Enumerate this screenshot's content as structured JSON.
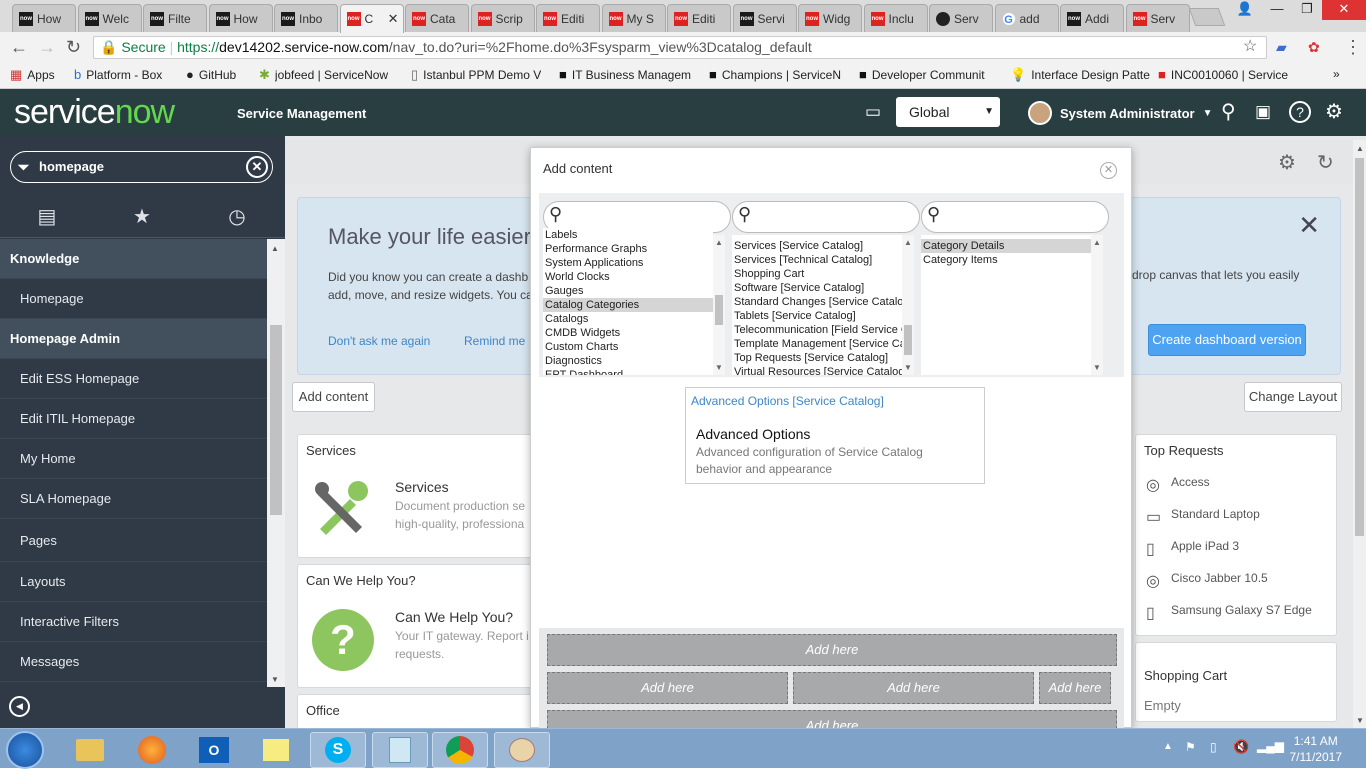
{
  "browser": {
    "tabs": [
      {
        "label": "How",
        "icon": "servicenow-icon",
        "active": false
      },
      {
        "label": "Welc",
        "icon": "servicenow-icon",
        "active": false
      },
      {
        "label": "Filte",
        "icon": "servicenow-icon",
        "active": false
      },
      {
        "label": "How",
        "icon": "servicenow-icon",
        "active": false
      },
      {
        "label": "Inbo",
        "icon": "servicenow-icon",
        "active": false
      },
      {
        "label": "C",
        "icon": "servicenow-red-icon",
        "active": true
      },
      {
        "label": "Cata",
        "icon": "servicenow-red-icon",
        "active": false
      },
      {
        "label": "Scrip",
        "icon": "servicenow-red-icon",
        "active": false
      },
      {
        "label": "Editi",
        "icon": "servicenow-red-icon",
        "active": false
      },
      {
        "label": "My S",
        "icon": "servicenow-red-icon",
        "active": false
      },
      {
        "label": "Editi",
        "icon": "servicenow-red-icon",
        "active": false
      },
      {
        "label": "Servi",
        "icon": "servicenow-icon",
        "active": false
      },
      {
        "label": "Widg",
        "icon": "servicenow-red-icon",
        "active": false
      },
      {
        "label": "Inclu",
        "icon": "servicenow-red-icon",
        "active": false
      },
      {
        "label": "Serv",
        "icon": "github-icon",
        "active": false
      },
      {
        "label": "add",
        "icon": "google-icon",
        "active": false
      },
      {
        "label": "Addi",
        "icon": "servicenow-icon",
        "active": false
      },
      {
        "label": "Serv",
        "icon": "servicenow-red-icon",
        "active": false
      }
    ],
    "address": {
      "secure_label": "Secure",
      "url_scheme": "https://",
      "url_host": "dev14202.service-now.com",
      "url_path": "/nav_to.do?uri=%2Fhome.do%3Fsysparm_view%3Dcatalog_default"
    },
    "bookmarks": [
      {
        "label": "Apps",
        "icon": "apps-grid-icon"
      },
      {
        "label": "Platform - Box",
        "icon": "box-icon"
      },
      {
        "label": "GitHub",
        "icon": "github-icon"
      },
      {
        "label": "jobfeed | ServiceNow",
        "icon": "jobfeed-icon"
      },
      {
        "label": "Istanbul PPM Demo V",
        "icon": "page-icon"
      },
      {
        "label": "IT Business Managem",
        "icon": "servicenow-icon"
      },
      {
        "label": "Champions | ServiceN",
        "icon": "servicenow-icon"
      },
      {
        "label": "Developer Communit",
        "icon": "servicenow-icon"
      },
      {
        "label": "Interface Design Patte",
        "icon": "lightbulb-icon"
      },
      {
        "label": "INC0010060 | Service",
        "icon": "servicenow-red-icon"
      }
    ],
    "more_bookmarks": "»"
  },
  "header": {
    "logo_service": "service",
    "logo_now": "now",
    "product": "Service Management",
    "scope": "Global",
    "user": "System Administrator"
  },
  "leftnav": {
    "filter_value": "homepage",
    "items": [
      {
        "label": "Knowledge",
        "type": "section"
      },
      {
        "label": "Homepage",
        "type": "item"
      },
      {
        "label": "Homepage Admin",
        "type": "section"
      },
      {
        "label": "Edit ESS Homepage",
        "type": "item"
      },
      {
        "label": "Edit ITIL Homepage",
        "type": "item"
      },
      {
        "label": "My Home",
        "type": "item"
      },
      {
        "label": "SLA Homepage",
        "type": "item"
      },
      {
        "label": "Pages",
        "type": "item"
      },
      {
        "label": "Layouts",
        "type": "item"
      },
      {
        "label": "Interactive Filters",
        "type": "item"
      },
      {
        "label": "Messages",
        "type": "item"
      }
    ]
  },
  "banner": {
    "title": "Make your life easier",
    "text": "Did you know you can create a dashb add, move, and resize widgets. You ca",
    "text_right": "drop canvas that lets you easily",
    "dont_ask": "Don't ask me again",
    "remind": "Remind me",
    "create_button": "Create dashboard version"
  },
  "toolbar": {
    "add_content": "Add content",
    "change_layout": "Change Layout"
  },
  "widgets": {
    "services": {
      "title": "Services",
      "name": "Services",
      "desc": "Document production se high-quality, professiona"
    },
    "help": {
      "title": "Can We Help You?",
      "name": "Can We Help You?",
      "desc": "Your IT gateway. Report i requests."
    },
    "office": {
      "title": "Office"
    },
    "top_requests": {
      "title": "Top Requests",
      "items": [
        {
          "label": "Access",
          "icon": "catalog-icon"
        },
        {
          "label": "Standard Laptop",
          "icon": "laptop-icon"
        },
        {
          "label": "Apple iPad 3",
          "icon": "tablet-icon"
        },
        {
          "label": "Cisco Jabber 10.5",
          "icon": "disc-icon"
        },
        {
          "label": "Samsung Galaxy S7 Edge",
          "icon": "phone-icon"
        }
      ]
    },
    "cart": {
      "title": "Shopping Cart",
      "status": "Empty"
    }
  },
  "modal": {
    "title": "Add content",
    "col1": [
      "Labels",
      "Performance Graphs",
      "System Applications",
      "World Clocks",
      "Gauges",
      "Catalog Categories",
      "Catalogs",
      "CMDB Widgets",
      "Custom Charts",
      "Diagnostics",
      "EPT Dashboard"
    ],
    "col1_selected": "Catalog Categories",
    "col2": [
      "Services [Service Catalog]",
      "Services [Technical Catalog]",
      "Shopping Cart",
      "Software [Service Catalog]",
      "Standard Changes [Service Catalog]",
      "Tablets [Service Catalog]",
      "Telecommunication [Field Service Catalog]",
      "Template Management [Service Catalog]",
      "Top Requests [Service Catalog]",
      "Virtual Resources [Service Catalog]"
    ],
    "col3": [
      "Category Details",
      "Category Items"
    ],
    "col3_selected": "Category Details",
    "preview": {
      "link": "Advanced Options [Service Catalog]",
      "title": "Advanced Options",
      "desc": "Advanced configuration of Service Catalog behavior and appearance"
    },
    "add_here": "Add here"
  },
  "taskbar": {
    "time": "1:41 AM",
    "date": "7/11/2017"
  },
  "colors": {
    "header_bg": "#293e40",
    "nav_bg": "#303a46",
    "accent_green": "#62d84e",
    "link_blue": "#3d86c6",
    "button_blue": "#4da2f2"
  }
}
